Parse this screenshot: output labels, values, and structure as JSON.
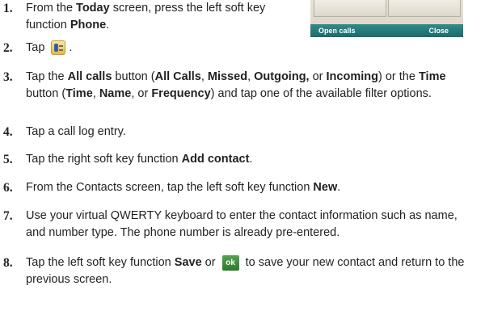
{
  "phone_screen": {
    "left_soft_key": "Open calls",
    "right_soft_key": "Close"
  },
  "steps": [
    {
      "number": "1.",
      "parts": [
        {
          "t": "From the "
        },
        {
          "t": "Today",
          "b": true
        },
        {
          "t": " screen, press the left soft key function "
        },
        {
          "t": "Phone",
          "b": true
        },
        {
          "t": "."
        }
      ]
    },
    {
      "number": "2.",
      "parts": [
        {
          "t": "Tap "
        },
        {
          "icon": "phone-icon"
        },
        {
          "t": "."
        }
      ]
    },
    {
      "number": "3.",
      "parts": [
        {
          "t": "Tap the "
        },
        {
          "t": "All calls",
          "b": true
        },
        {
          "t": " button ("
        },
        {
          "t": "All Calls",
          "b": true
        },
        {
          "t": ", "
        },
        {
          "t": "Missed",
          "b": true
        },
        {
          "t": ", "
        },
        {
          "t": "Outgoing,",
          "b": true
        },
        {
          "t": " or "
        },
        {
          "t": "Incoming",
          "b": true
        },
        {
          "t": ") or the "
        },
        {
          "t": "Time",
          "b": true
        },
        {
          "t": " button ("
        },
        {
          "t": "Time",
          "b": true
        },
        {
          "t": ", "
        },
        {
          "t": "Name",
          "b": true
        },
        {
          "t": ", or "
        },
        {
          "t": "Frequency",
          "b": true
        },
        {
          "t": ") and tap one of the available filter options."
        }
      ]
    },
    {
      "number": "4.",
      "parts": [
        {
          "t": "Tap a call log entry."
        }
      ]
    },
    {
      "number": "5.",
      "parts": [
        {
          "t": "Tap the right soft key function "
        },
        {
          "t": "Add contact",
          "b": true
        },
        {
          "t": "."
        }
      ]
    },
    {
      "number": "6.",
      "parts": [
        {
          "t": "From the Contacts screen, tap the left soft key function "
        },
        {
          "t": "New",
          "b": true
        },
        {
          "t": "."
        }
      ]
    },
    {
      "number": "7.",
      "parts": [
        {
          "t": "Use your virtual QWERTY keyboard to enter the contact information such as name, and number type. The phone number is already pre-entered."
        }
      ]
    },
    {
      "number": "8.",
      "parts": [
        {
          "t": "Tap the left soft key function "
        },
        {
          "t": "Save",
          "b": true
        },
        {
          "t": " or "
        },
        {
          "icon": "ok-icon",
          "label": "ok"
        },
        {
          "t": " to save your new contact and return to the previous screen."
        }
      ]
    }
  ]
}
